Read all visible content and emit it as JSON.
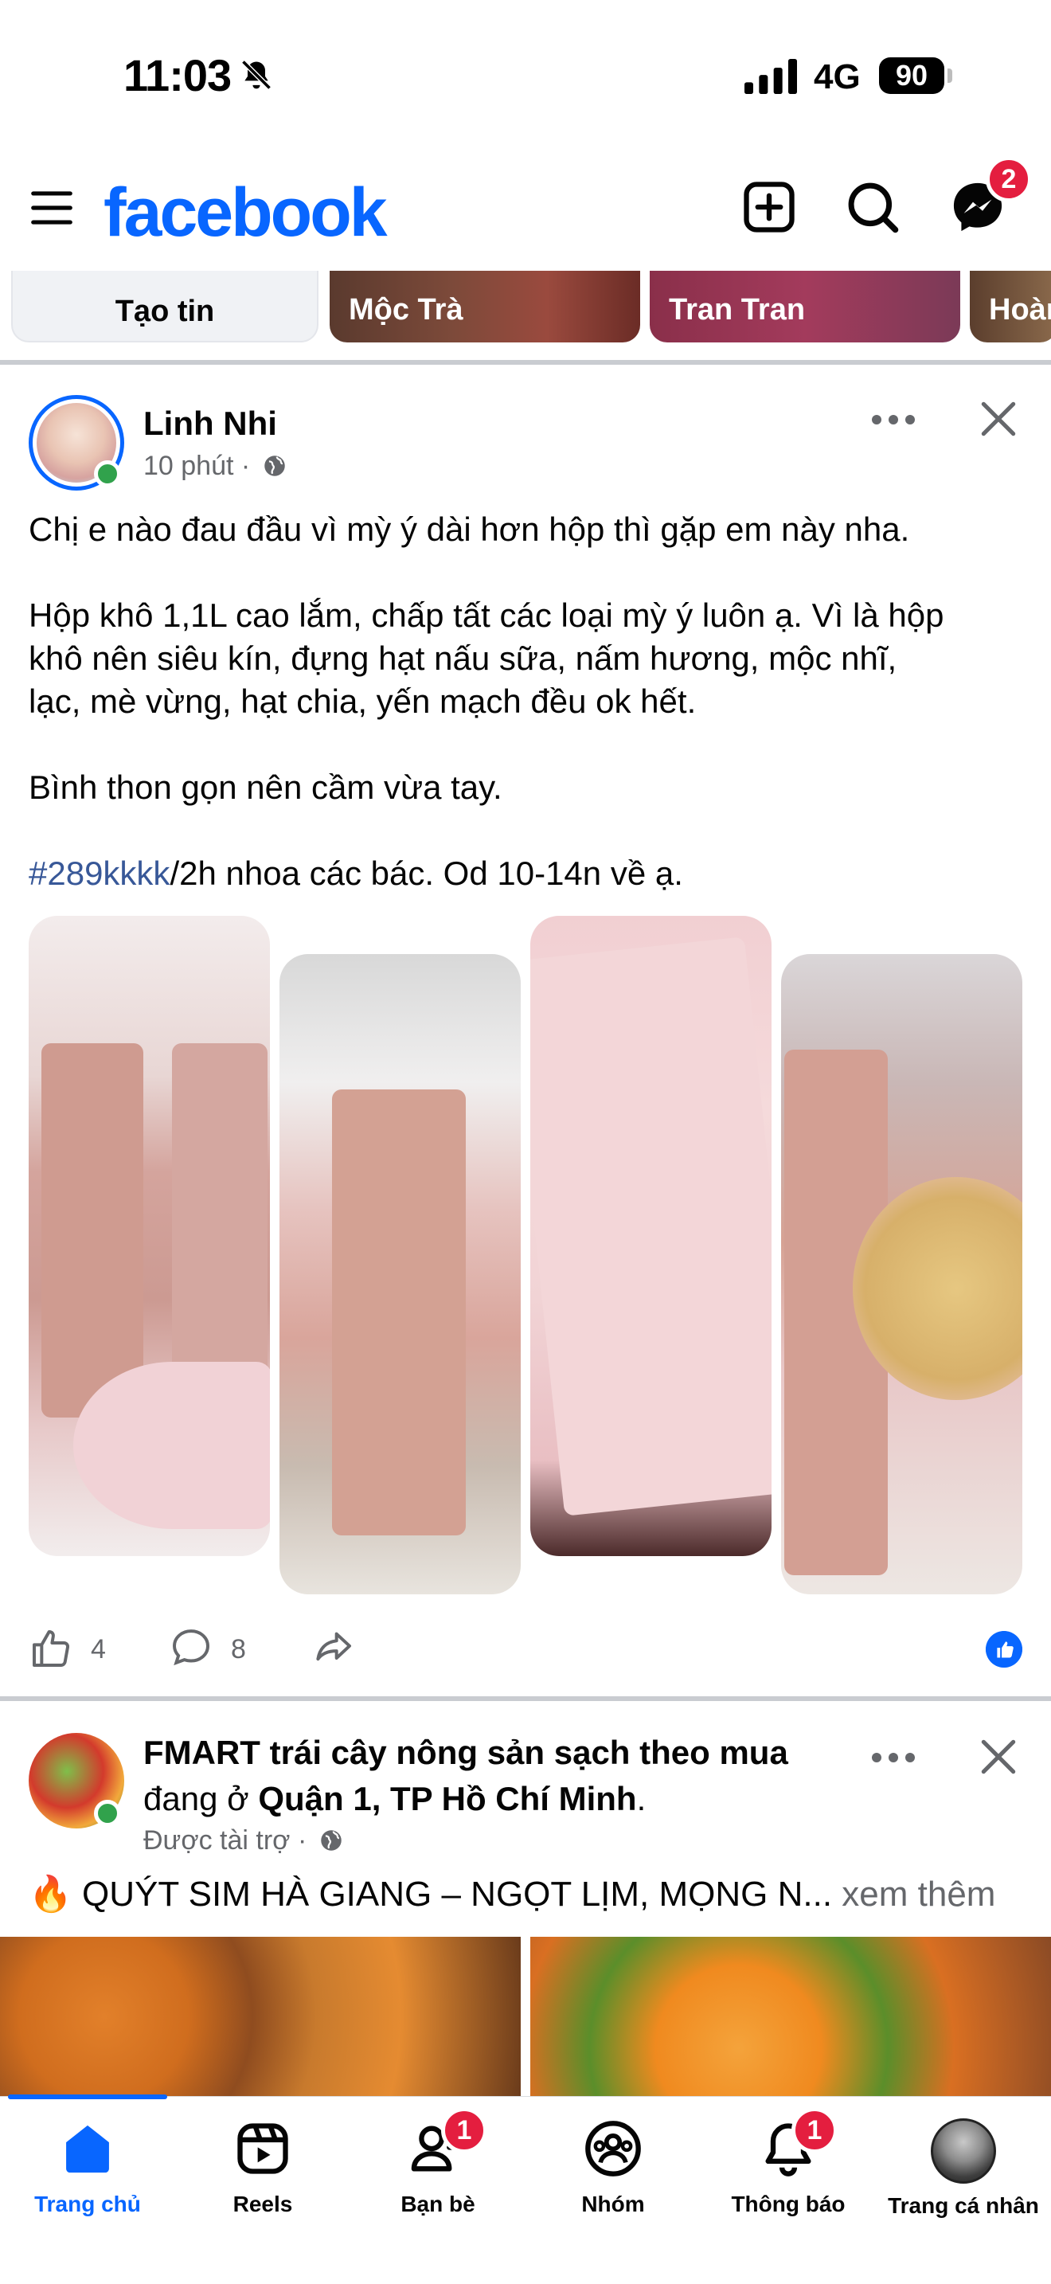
{
  "status_bar": {
    "time": "11:03",
    "network": "4G",
    "battery": "90"
  },
  "header": {
    "logo": "facebook",
    "messenger_badge": "2",
    "brand_color": "#0866ff"
  },
  "stories": [
    {
      "name": "Tạo tin"
    },
    {
      "name": "Mộc Trà"
    },
    {
      "name": "Tran Tran"
    },
    {
      "name": "Hoàn"
    }
  ],
  "post1": {
    "author": "Linh Nhi",
    "time": "10 phút",
    "separator": "·",
    "text_line1": "Chị e nào đau đầu vì mỳ ý dài hơn hộp thì gặp em này nha.",
    "text_para2_l1": "Hộp khô 1,1L cao lắm, chấp tất các loại mỳ ý luôn ạ. Vì là hộp",
    "text_para2_l2": "khô nên siêu kín, đựng hạt nấu sữa, nấm hương, mộc nhĩ,",
    "text_para2_l3": "lạc, mè vừng, hạt chia, yến mạch đều ok hết.",
    "text_para3": "Bình thon gọn nên cầm vừa tay.",
    "hashtag": "#289kkkk",
    "text_para4_rest": "/2h nhoa các bác. Od 10-14n về ạ.",
    "likes": "4",
    "comments": "8"
  },
  "post2": {
    "name_part1": "FMART trái cây nông sản sạch theo mua",
    "name_part2": "đang ở ",
    "location": "Quận 1, TP Hồ Chí Minh",
    "name_end": ".",
    "sponsored": "Được tài trợ",
    "separator": "·",
    "text": "🔥 QUÝT SIM HÀ GIANG – NGỌT LỊM, MỌNG N...",
    "see_more": "xem thêm"
  },
  "bottom_nav": [
    {
      "label": "Trang chủ"
    },
    {
      "label": "Reels"
    },
    {
      "label": "Bạn bè",
      "badge": "1"
    },
    {
      "label": "Nhóm"
    },
    {
      "label": "Thông báo",
      "badge": "1"
    },
    {
      "label": "Trang cá nhân"
    }
  ]
}
